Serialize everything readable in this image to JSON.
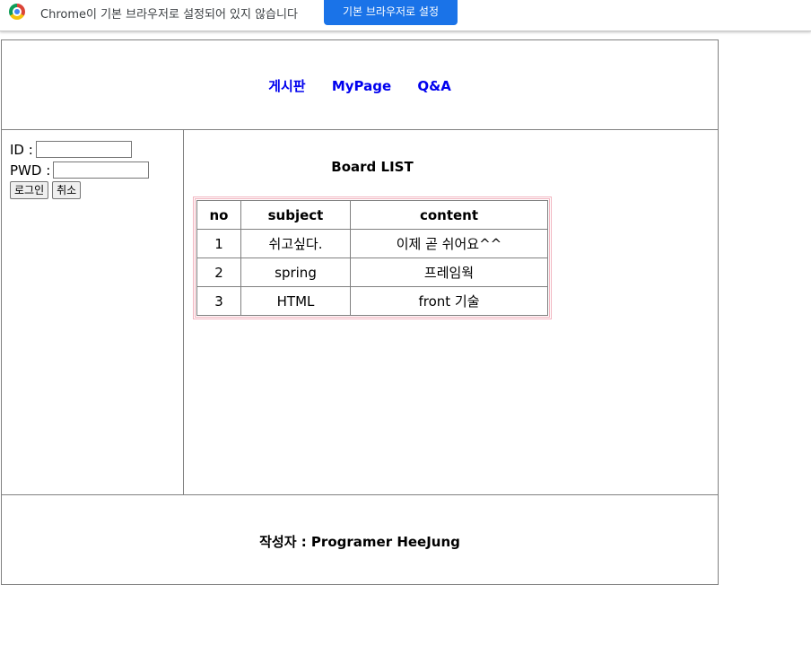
{
  "infobar": {
    "message": "Chrome이 기본 브라우저로 설정되어 있지 않습니다",
    "button_label": "기본 브라우저로 설정",
    "logo_icon": "chrome-logo-icon"
  },
  "nav": {
    "items": [
      "게시판",
      "MyPage",
      "Q&A"
    ],
    "link_color": "#0000ee"
  },
  "login": {
    "id_label": "ID :",
    "id_value": "",
    "pwd_label": "PWD :",
    "pwd_value": "",
    "login_button": "로그인",
    "cancel_button": "취소"
  },
  "board": {
    "title": "Board LIST",
    "columns": [
      "no",
      "subject",
      "content"
    ],
    "rows": [
      [
        "1",
        "쉬고싶다.",
        "이제 곧 쉬어요^^"
      ],
      [
        "2",
        "spring",
        "프레임웍"
      ],
      [
        "3",
        "HTML",
        "front 기술"
      ]
    ],
    "border_color": "#f2b5c0"
  },
  "footer": {
    "text": "작성자 : Programer HeeJung"
  }
}
